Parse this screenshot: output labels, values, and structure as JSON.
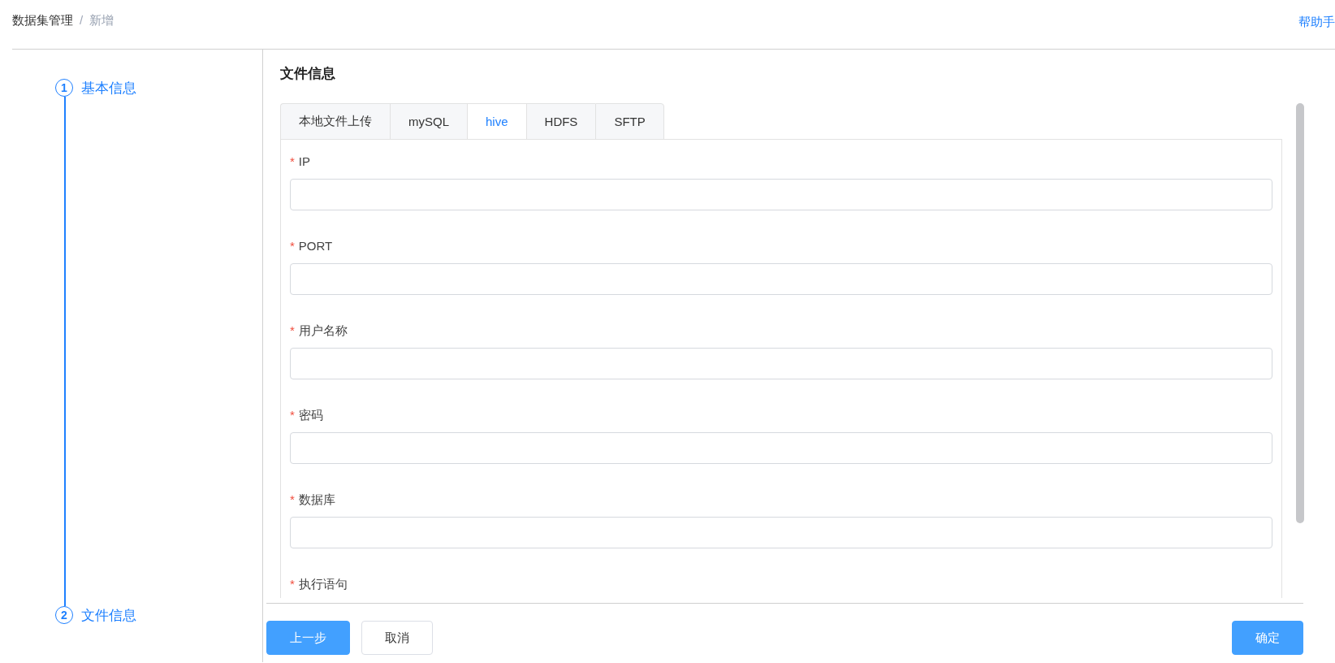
{
  "breadcrumb": [
    {
      "label": "数据集管理",
      "current": false
    },
    {
      "label": "新增",
      "current": true
    }
  ],
  "breadcrumb_separator": "/",
  "help_link": "帮助手",
  "steps": [
    {
      "number": "1",
      "label": "基本信息"
    },
    {
      "number": "2",
      "label": "文件信息"
    }
  ],
  "section_title": "文件信息",
  "tabs": [
    {
      "label": "本地文件上传",
      "selected": false
    },
    {
      "label": "mySQL",
      "selected": false
    },
    {
      "label": "hive",
      "selected": true
    },
    {
      "label": "HDFS",
      "selected": false
    },
    {
      "label": "SFTP",
      "selected": false
    }
  ],
  "fields": [
    {
      "marker": "*",
      "label": "IP",
      "kind": "input"
    },
    {
      "marker": "*",
      "label": "PORT",
      "kind": "input"
    },
    {
      "marker": "*",
      "label": "用户名称",
      "kind": "input"
    },
    {
      "marker": "*",
      "label": "密码",
      "kind": "input"
    },
    {
      "marker": "*",
      "label": "数据库",
      "kind": "input"
    },
    {
      "marker": "*",
      "label": "执行语句",
      "kind": "label-only"
    }
  ],
  "buttons": [
    {
      "label": "上一步",
      "kind": "primary"
    },
    {
      "label": "取消",
      "kind": "default"
    },
    {
      "label": "确定",
      "kind": "primary"
    }
  ]
}
